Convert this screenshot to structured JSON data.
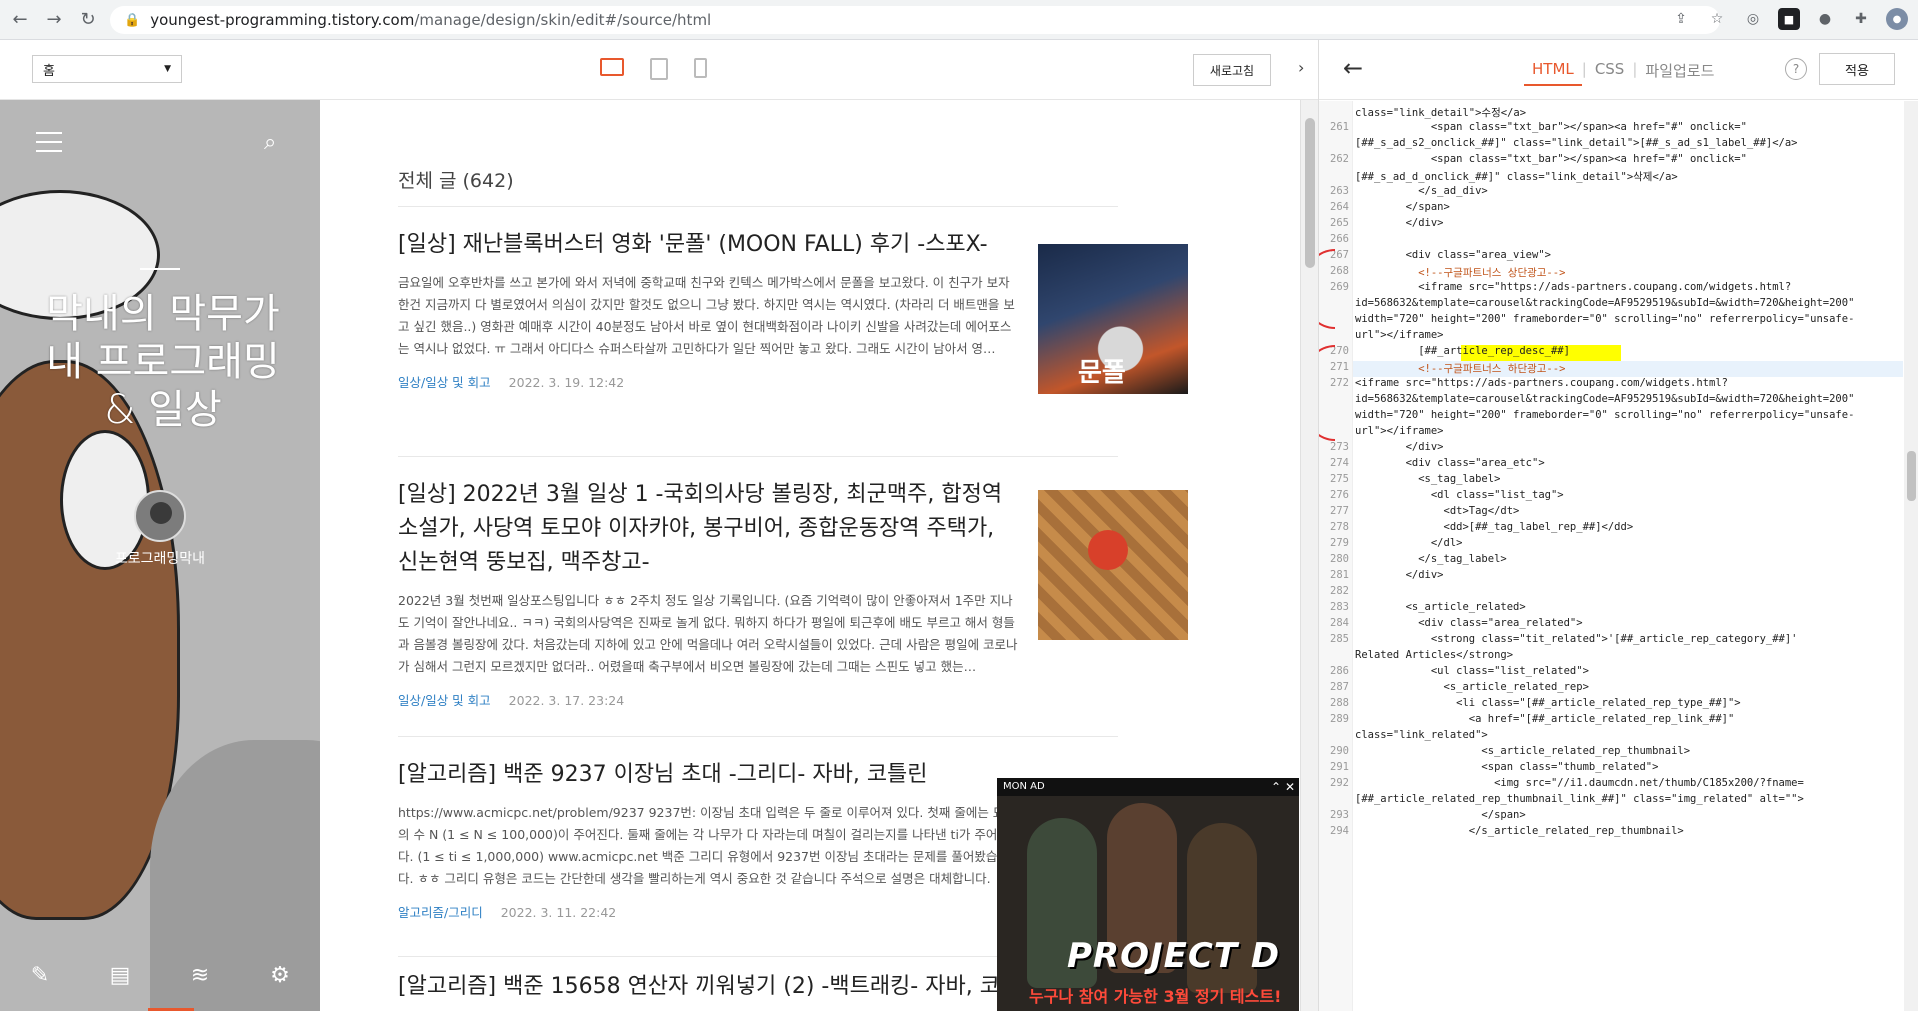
{
  "browser": {
    "url_host": "youngest-programming.tistory.com",
    "url_path": "/manage/design/skin/edit#/source/html",
    "nav": [
      "back-arrow",
      "forward-arrow",
      "reload"
    ],
    "extensions": [
      "share-icon",
      "star-icon",
      "ext-circle",
      "ext-dark-1",
      "github-icon",
      "puzzle-icon",
      "profile-avatar"
    ]
  },
  "toolbar": {
    "page_select": "홈",
    "refresh_label": "새로고침"
  },
  "blog": {
    "title": "막내의 막무가내 프로그래밍 & 일상",
    "profile_name": "프로그래밍막내"
  },
  "main": {
    "total_label": "전체 글 (642)",
    "posts": [
      {
        "title": "[일상] 재난블록버스터 영화 '문폴' (MOON FALL) 후기 -스포X-",
        "summary": "금요일에 오후반차를 쓰고 본가에 와서 저녁에 중학교때 친구와 킨텍스 메가박스에서 문폴을 보고왔다. 이 친구가 보자 한건 지금까지 다 별로였어서 의심이 갔지만 할것도 없으니 그냥 봤다. 하지만 역시는 역시였다. (차라리 더 배트맨을 보고 싶긴 했음..) 영화관 예매후 시간이 40분정도 남아서 바로 옆이 현대백화점이라 나이키 신발을 사려갔는데 에어포스는 역시나 없었다. ㅠ 그래서 아디다스 슈퍼스타살까 고민하다가 일단 찍어만 놓고 왔다. 그래도 시간이 남아서 영…",
        "category": "일상/일상 및 회고",
        "date": "2022. 3. 19. 12:42",
        "thumb_text": "문폴"
      },
      {
        "title": "[일상] 2022년 3월 일상 1 -국회의사당 볼링장, 최군맥주, 합정역 소설가, 사당역 토모야 이자카야, 봉구비어, 종합운동장역 주택가, 신논현역 뚱보집, 맥주창고-",
        "summary": "2022년 3월 첫번째 일상포스팅입니다 ㅎㅎ 2주치 정도 일상 기록입니다. (요즘 기억력이 많이 안좋아져서 1주만 지나도 기억이 잘안나네요.. ㅋㅋ) 국회의사당역은 진짜로 놀게 없다. 뭐하지 하다가 평일에 퇴근후에 배도 부르고 해서 형들과 음볼경 볼링장에 갔다. 처음갔는데 지하에 있고 안에 먹을데나 여러 오락시설들이 있었다. 근데 사람은 평일에 코로나가 심해서 그런지 모르겠지만 없더라.. 어렸을때 축구부에서 비오면 볼링장에 갔는데 그때는 스핀도 넣고 했는…",
        "category": "일상/일상 및 회고",
        "date": "2022. 3. 17. 23:24"
      },
      {
        "title": "[알고리즘] 백준 9237 이장님 초대 -그리디- 자바, 코틀린",
        "summary": "https://www.acmicpc.net/problem/9237 9237번: 이장님 초대 입력은 두 줄로 이루어져 있다. 첫째 줄에는 묘목의 수 N (1 ≤ N ≤ 100,000)이 주어진다. 둘째 줄에는 각 나무가 다 자라는데 며칠이 걸리는지를 나타낸 ti가 주어진다. (1 ≤ ti ≤ 1,000,000) www.acmicpc.net 백준 그리디 유형에서 9237번 이장님 초대라는 문제를 풀어봤습니다. ㅎㅎ 그리디 유형은 코드는 간단한데 생각을 빨리하는게 역시 중요한 것 같습니다 주석으로 설명은 대체합니다.",
        "category": "알고리즘/그리디",
        "date": "2022. 3. 11. 22:42"
      },
      {
        "title": "[알고리즘] 백준 15658 연산자 끼워넣기 (2) -백트래킹- 자바, 코틀린"
      }
    ]
  },
  "ad": {
    "label": "MON AD",
    "title": "PROJECT D",
    "subtitle": "누구나 참여 가능한 3월 정기 테스트!"
  },
  "editor": {
    "tabs": [
      "HTML",
      "CSS",
      "파일업로드"
    ],
    "active_tab": "HTML",
    "help": "?",
    "apply_label": "적용",
    "lines": [
      {
        "n": "",
        "t": "class=\"link_detail\">수정</a>"
      },
      {
        "n": "261",
        "t": "            <span class=\"txt_bar\"></span><a href=\"#\" onclick=\""
      },
      {
        "n": "",
        "t": "[##_s_ad_s2_onclick_##]\" class=\"link_detail\">[##_s_ad_s1_label_##]</a>"
      },
      {
        "n": "262",
        "t": "            <span class=\"txt_bar\"></span><a href=\"#\" onclick=\""
      },
      {
        "n": "",
        "t": "[##_s_ad_d_onclick_##]\" class=\"link_detail\">삭제</a>"
      },
      {
        "n": "263",
        "t": "          </s_ad_div>"
      },
      {
        "n": "264",
        "t": "        </span>"
      },
      {
        "n": "265",
        "t": "        </div>"
      },
      {
        "n": "266",
        "t": ""
      },
      {
        "n": "267",
        "t": "        <div class=\"area_view\">"
      },
      {
        "n": "268",
        "t": "          <!--구글파트너스 상단광고-->"
      },
      {
        "n": "269",
        "t": "          <iframe src=\"https://ads-partners.coupang.com/widgets.html?"
      },
      {
        "n": "",
        "t": "id=568632&template=carousel&trackingCode=AF9529519&subId=&width=720&height=200\""
      },
      {
        "n": "",
        "t": "width=\"720\" height=\"200\" frameborder=\"0\" scrolling=\"no\" referrerpolicy=\"unsafe-"
      },
      {
        "n": "",
        "t": "url\"></iframe>"
      },
      {
        "n": "270",
        "t": "          [##_article_rep_desc_##]"
      },
      {
        "n": "271",
        "t": "          <!--구글파트너스 하단광고-->"
      },
      {
        "n": "272",
        "t": "<iframe src=\"https://ads-partners.coupang.com/widgets.html?"
      },
      {
        "n": "",
        "t": "id=568632&template=carousel&trackingCode=AF9529519&subId=&width=720&height=200\""
      },
      {
        "n": "",
        "t": "width=\"720\" height=\"200\" frameborder=\"0\" scrolling=\"no\" referrerpolicy=\"unsafe-"
      },
      {
        "n": "",
        "t": "url\"></iframe>"
      },
      {
        "n": "273",
        "t": "        </div>"
      },
      {
        "n": "274",
        "t": "        <div class=\"area_etc\">"
      },
      {
        "n": "275",
        "t": "          <s_tag_label>"
      },
      {
        "n": "276",
        "t": "            <dl class=\"list_tag\">"
      },
      {
        "n": "277",
        "t": "              <dt>Tag</dt>"
      },
      {
        "n": "278",
        "t": "              <dd>[##_tag_label_rep_##]</dd>"
      },
      {
        "n": "279",
        "t": "            </dl>"
      },
      {
        "n": "280",
        "t": "          </s_tag_label>"
      },
      {
        "n": "281",
        "t": "        </div>"
      },
      {
        "n": "282",
        "t": ""
      },
      {
        "n": "283",
        "t": "        <s_article_related>"
      },
      {
        "n": "284",
        "t": "          <div class=\"area_related\">"
      },
      {
        "n": "285",
        "t": "            <strong class=\"tit_related\">'[##_article_rep_category_##]'"
      },
      {
        "n": "",
        "t": "Related Articles</strong>"
      },
      {
        "n": "286",
        "t": "            <ul class=\"list_related\">"
      },
      {
        "n": "287",
        "t": "              <s_article_related_rep>"
      },
      {
        "n": "288",
        "t": "                <li class=\"[##_article_related_rep_type_##]\">"
      },
      {
        "n": "289",
        "t": "                  <a href=\"[##_article_related_rep_link_##]\""
      },
      {
        "n": "",
        "t": "class=\"link_related\">"
      },
      {
        "n": "290",
        "t": "                    <s_article_related_rep_thumbnail>"
      },
      {
        "n": "291",
        "t": "                    <span class=\"thumb_related\">"
      },
      {
        "n": "292",
        "t": "                      <img src=\"//i1.daumcdn.net/thumb/C185x200/?fname="
      },
      {
        "n": "",
        "t": "[##_article_related_rep_thumbnail_link_##]\" class=\"img_related\" alt=\"\">"
      },
      {
        "n": "293",
        "t": "                    </span>"
      },
      {
        "n": "294",
        "t": "                  </s_article_related_rep_thumbnail>"
      }
    ]
  }
}
